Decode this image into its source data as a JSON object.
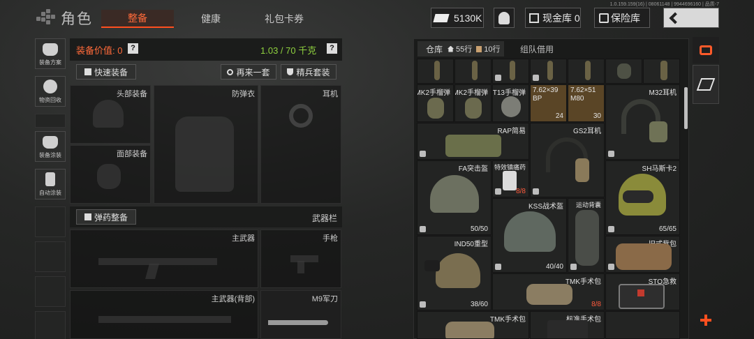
{
  "header": {
    "title": "角色",
    "tabs": [
      {
        "label": "整备",
        "active": true
      },
      {
        "label": "健康",
        "active": false
      },
      {
        "label": "礼包卡券",
        "active": false
      }
    ],
    "version": "1.0.159.159(16) | 08061148 | 9944696160 | 品质-7",
    "currency": "5130K",
    "cash_storage": "现金库 0",
    "insurance": "保险库"
  },
  "side_menu": [
    {
      "label": "装备方案",
      "icon": "backpack-icon"
    },
    {
      "label": "物资回收",
      "icon": "recycle-icon"
    },
    {
      "label": "装备涂装",
      "icon": "helmet-paint-icon"
    },
    {
      "label": "自动涂装",
      "icon": "spray-icon"
    }
  ],
  "equipment": {
    "value_label": "装备价值:",
    "value": "0",
    "weight": "1.03 / 70 千克",
    "quick_equip": "快速装备",
    "again": "再来一套",
    "elite_set": "精兵套装",
    "ammo_equip": "弹药整备",
    "weapon_bar": "武器栏",
    "slots": {
      "head": "头部装备",
      "armor": "防弹衣",
      "earphone": "耳机",
      "face": "面部装备",
      "primary": "主武器",
      "pistol": "手枪",
      "primary_back": "主武器(背部)",
      "knife": "M9军刀"
    }
  },
  "storage": {
    "tab_warehouse": "仓库",
    "rows_home": "55行",
    "rows_bag": "10行",
    "tab_team": "组队借用",
    "items": [
      {
        "name": "MK2手榴弹",
        "count": ""
      },
      {
        "name": "MK2手榴弹",
        "count": ""
      },
      {
        "name": "T13手榴弹",
        "count": ""
      },
      {
        "name": "7.62×39 BP",
        "count": "24"
      },
      {
        "name": "7.62×51 M80",
        "count": "30"
      },
      {
        "name": "M32耳机",
        "count": ""
      },
      {
        "name": "RAP简易",
        "count": ""
      },
      {
        "name": "GS2耳机",
        "count": ""
      },
      {
        "name": "FA突击盔",
        "count": ""
      },
      {
        "name": "特效镇痛药",
        "count": "8/8"
      },
      {
        "name": "SH马斯卡2",
        "count": "65/65"
      },
      {
        "name": "KSS战术盔",
        "count": "40/40"
      },
      {
        "name": "运动背囊",
        "count": ""
      },
      {
        "name": "IND50重型",
        "count": "38/60"
      },
      {
        "name": "旧式背包",
        "count": ""
      },
      {
        "name": "TMK手术包",
        "count": "8/8"
      },
      {
        "name": "STO急救",
        "count": ""
      },
      {
        "name": "TMK手术包",
        "count": ""
      },
      {
        "name": "标准手术包",
        "count": ""
      }
    ],
    "fa_count": "50/50"
  },
  "colors": {
    "accent": "#ff4f1f",
    "green_value": "#8fd13f",
    "red_count": "#ff5a3c"
  }
}
